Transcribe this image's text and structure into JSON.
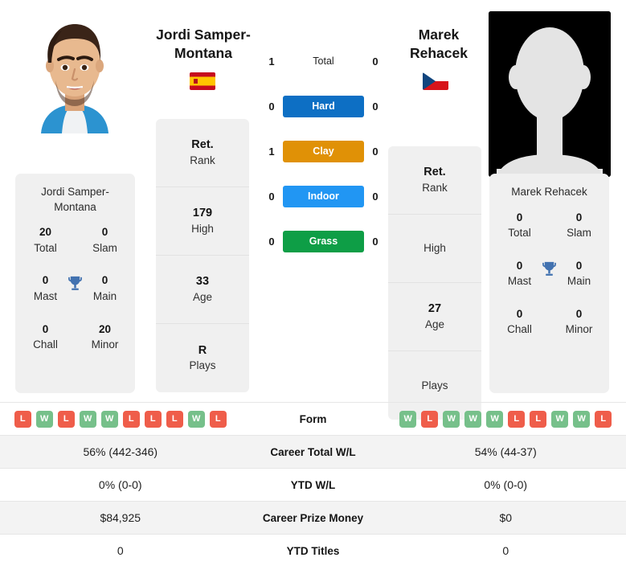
{
  "players": {
    "left": {
      "name": "Jordi Samper-Montana",
      "name_line1": "Jordi Samper-",
      "name_line2": "Montana",
      "country": "Spain",
      "flag": "spain-flag",
      "photo": "player-photo-jordi-samper-montana",
      "titles_card_name": "Jordi Samper-Montana",
      "rank": {
        "value": "Ret.",
        "label": "Rank"
      },
      "high": {
        "value": "179",
        "label": "High"
      },
      "age": {
        "value": "33",
        "label": "Age"
      },
      "plays": {
        "value": "R",
        "label": "Plays"
      },
      "titles": {
        "total": {
          "value": "20",
          "label": "Total"
        },
        "slam": {
          "value": "0",
          "label": "Slam"
        },
        "mast": {
          "value": "0",
          "label": "Mast"
        },
        "main": {
          "value": "0",
          "label": "Main"
        },
        "chall": {
          "value": "0",
          "label": "Chall"
        },
        "minor": {
          "value": "20",
          "label": "Minor"
        }
      },
      "form": [
        "L",
        "W",
        "L",
        "W",
        "W",
        "L",
        "L",
        "L",
        "W",
        "L"
      ]
    },
    "right": {
      "name": "Marek Rehacek",
      "name_line1": "Marek",
      "name_line2": "Rehacek",
      "country": "Czech Republic",
      "flag": "czech-republic-flag",
      "photo": "player-photo-placeholder-silhouette",
      "titles_card_name": "Marek Rehacek",
      "rank": {
        "value": "Ret.",
        "label": "Rank"
      },
      "high": {
        "value": "",
        "label": "High"
      },
      "age": {
        "value": "27",
        "label": "Age"
      },
      "plays": {
        "value": "",
        "label": "Plays"
      },
      "titles": {
        "total": {
          "value": "0",
          "label": "Total"
        },
        "slam": {
          "value": "0",
          "label": "Slam"
        },
        "mast": {
          "value": "0",
          "label": "Mast"
        },
        "main": {
          "value": "0",
          "label": "Main"
        },
        "chall": {
          "value": "0",
          "label": "Chall"
        },
        "minor": {
          "value": "0",
          "label": "Minor"
        }
      },
      "form": [
        "W",
        "L",
        "W",
        "W",
        "W",
        "L",
        "L",
        "W",
        "W",
        "L"
      ]
    }
  },
  "h2h": {
    "rows": [
      {
        "label": "Total",
        "left": "1",
        "right": "0",
        "style": "plain",
        "color": ""
      },
      {
        "label": "Hard",
        "left": "0",
        "right": "0",
        "style": "bar",
        "color": "#0d6fc4"
      },
      {
        "label": "Clay",
        "left": "1",
        "right": "0",
        "style": "bar",
        "color": "#e09106"
      },
      {
        "label": "Indoor",
        "left": "0",
        "right": "0",
        "style": "bar",
        "color": "#2196f3"
      },
      {
        "label": "Grass",
        "left": "0",
        "right": "0",
        "style": "bar",
        "color": "#0e9e46"
      }
    ]
  },
  "stats_table": {
    "rows": [
      {
        "label": "Form",
        "left": "",
        "right": "",
        "type": "form",
        "shaded": false
      },
      {
        "label": "Career Total W/L",
        "left": "56% (442-346)",
        "right": "54% (44-37)",
        "type": "text",
        "shaded": true
      },
      {
        "label": "YTD W/L",
        "left": "0% (0-0)",
        "right": "0% (0-0)",
        "type": "text",
        "shaded": false
      },
      {
        "label": "Career Prize Money",
        "left": "$84,925",
        "right": "$0",
        "type": "text",
        "shaded": true
      },
      {
        "label": "YTD Titles",
        "left": "0",
        "right": "0",
        "type": "text",
        "shaded": false
      }
    ]
  },
  "colors": {
    "hard": "#0d6fc4",
    "clay": "#e09106",
    "indoor": "#2196f3",
    "grass": "#0e9e46",
    "win_badge": "#76c08a",
    "loss_badge": "#ef5d4a",
    "card_bg": "#f0f0f0",
    "trophy": "#4272b0"
  }
}
